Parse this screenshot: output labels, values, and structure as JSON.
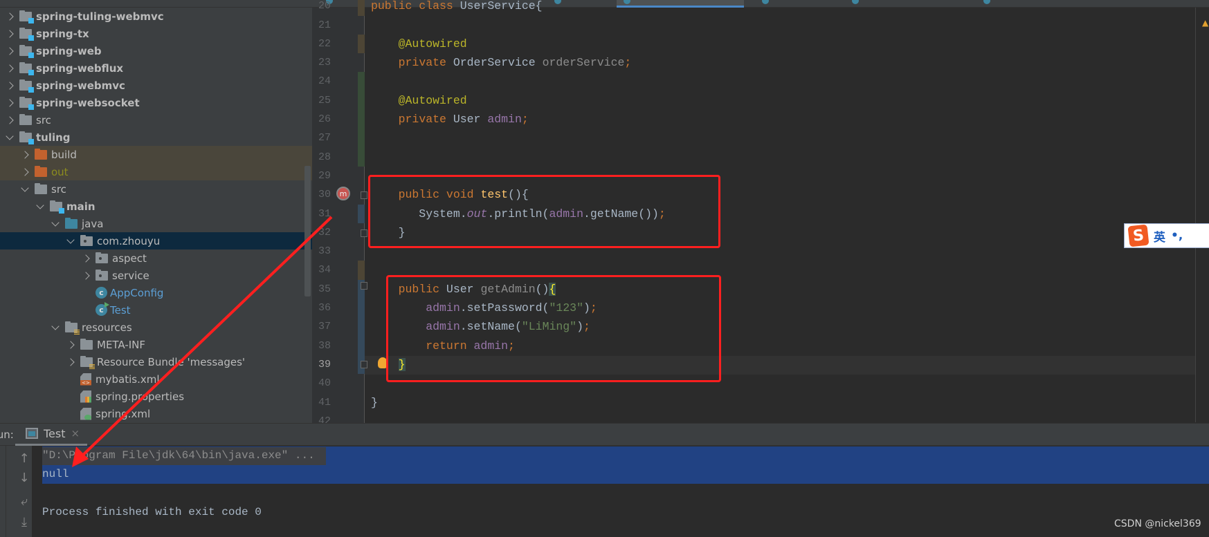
{
  "project_tree": [
    {
      "label": "spring-tuling-webmvc",
      "level": 0,
      "icon": "module-folder-icon",
      "expanded": false,
      "bold": true
    },
    {
      "label": "spring-tx",
      "level": 0,
      "icon": "module-folder-icon",
      "expanded": false,
      "bold": true
    },
    {
      "label": "spring-web",
      "level": 0,
      "icon": "module-folder-icon",
      "expanded": false,
      "bold": true
    },
    {
      "label": "spring-webflux",
      "level": 0,
      "icon": "module-folder-icon",
      "expanded": false,
      "bold": true
    },
    {
      "label": "spring-webmvc",
      "level": 0,
      "icon": "module-folder-icon",
      "expanded": false,
      "bold": true
    },
    {
      "label": "spring-websocket",
      "level": 0,
      "icon": "module-folder-icon",
      "expanded": false,
      "bold": true
    },
    {
      "label": "src",
      "level": 0,
      "icon": "folder-icon",
      "expanded": false
    },
    {
      "label": "tuling",
      "level": 0,
      "icon": "module-folder-icon",
      "expanded": true,
      "bold": true
    },
    {
      "label": "build",
      "level": 1,
      "icon": "excluded-folder-icon",
      "expanded": false,
      "excluded": true
    },
    {
      "label": "out",
      "level": 1,
      "icon": "excluded-folder-icon",
      "expanded": false,
      "excluded": true,
      "color": "olive"
    },
    {
      "label": "src",
      "level": 1,
      "icon": "folder-icon",
      "expanded": true
    },
    {
      "label": "main",
      "level": 2,
      "icon": "module-folder-icon",
      "expanded": true,
      "bold": true
    },
    {
      "label": "java",
      "level": 3,
      "icon": "source-folder-icon",
      "expanded": true
    },
    {
      "label": "com.zhouyu",
      "level": 4,
      "icon": "package-icon",
      "expanded": true,
      "selected": true
    },
    {
      "label": "aspect",
      "level": 5,
      "icon": "package-icon",
      "expanded": false
    },
    {
      "label": "service",
      "level": 5,
      "icon": "package-icon",
      "expanded": false
    },
    {
      "label": "AppConfig",
      "level": 5,
      "icon": "class-icon",
      "leaf": true,
      "color": "blue"
    },
    {
      "label": "Test",
      "level": 5,
      "icon": "runnable-class-icon",
      "leaf": true,
      "color": "blue"
    },
    {
      "label": "resources",
      "level": 3,
      "icon": "resources-folder-icon",
      "expanded": true
    },
    {
      "label": "META-INF",
      "level": 4,
      "icon": "folder-icon",
      "expanded": false
    },
    {
      "label": "Resource Bundle 'messages'",
      "level": 4,
      "icon": "resource-bundle-icon",
      "expanded": false
    },
    {
      "label": "mybatis.xml",
      "level": 4,
      "icon": "xml-file-icon",
      "leaf": true
    },
    {
      "label": "spring.properties",
      "level": 4,
      "icon": "properties-file-icon",
      "leaf": true
    },
    {
      "label": "spring.xml",
      "level": 4,
      "icon": "spring-xml-file-icon",
      "leaf": true
    }
  ],
  "editor": {
    "first_line": 20,
    "current_line": 39,
    "lines": [
      [
        {
          "t": "public class ",
          "c": "kw"
        },
        {
          "t": "UserService{",
          "c": ""
        }
      ],
      [],
      [
        {
          "t": "    "
        },
        {
          "t": "@Autowired",
          "c": "ann"
        }
      ],
      [
        {
          "t": "    "
        },
        {
          "t": "private ",
          "c": "kw"
        },
        {
          "t": "OrderService ",
          "c": ""
        },
        {
          "t": "orderService",
          "c": "unused"
        },
        {
          "t": ";",
          "c": "kw"
        }
      ],
      [],
      [
        {
          "t": "    "
        },
        {
          "t": "@Autowired",
          "c": "ann"
        }
      ],
      [
        {
          "t": "    "
        },
        {
          "t": "private ",
          "c": "kw"
        },
        {
          "t": "User ",
          "c": ""
        },
        {
          "t": "admin",
          "c": "fld"
        },
        {
          "t": ";",
          "c": "kw"
        }
      ],
      [],
      [],
      [],
      [
        {
          "t": "    "
        },
        {
          "t": "public void ",
          "c": "kw"
        },
        {
          "t": "test",
          "c": "mdecl"
        },
        {
          "t": "(){",
          "c": ""
        }
      ],
      [
        {
          "t": "       System."
        },
        {
          "t": "out",
          "c": "fld",
          "i": true
        },
        {
          "t": ".println("
        },
        {
          "t": "admin",
          "c": "fld"
        },
        {
          "t": ".getName())"
        },
        {
          "t": ";",
          "c": "kw"
        }
      ],
      [
        {
          "t": "    }"
        }
      ],
      [],
      [],
      [
        {
          "t": "    "
        },
        {
          "t": "public ",
          "c": "kw"
        },
        {
          "t": "User ",
          "c": ""
        },
        {
          "t": "getAdmin",
          "c": "unused"
        },
        {
          "t": "()"
        },
        {
          "t": "{",
          "c": "brace-hl"
        }
      ],
      [
        {
          "t": "        "
        },
        {
          "t": "admin",
          "c": "fld"
        },
        {
          "t": ".setPassword("
        },
        {
          "t": "\"123\"",
          "c": "str"
        },
        {
          "t": ")"
        },
        {
          "t": ";",
          "c": "kw"
        }
      ],
      [
        {
          "t": "        "
        },
        {
          "t": "admin",
          "c": "fld"
        },
        {
          "t": ".setName("
        },
        {
          "t": "\"LiMing\"",
          "c": "str"
        },
        {
          "t": ")"
        },
        {
          "t": ";",
          "c": "kw"
        }
      ],
      [
        {
          "t": "        "
        },
        {
          "t": "return ",
          "c": "kw"
        },
        {
          "t": "admin",
          "c": "fld"
        },
        {
          "t": ";",
          "c": "kw"
        }
      ],
      [
        {
          "t": "    "
        },
        {
          "t": "}",
          "c": "brace-hl"
        }
      ],
      [],
      [
        {
          "t": "}"
        }
      ],
      []
    ],
    "gutter_mark": "m",
    "colors": {
      "keyword": "#cc7832",
      "annotation": "#bbb529",
      "field": "#9876aa",
      "string": "#6a8759",
      "method": "#ffc66d",
      "text": "#a9b7c6"
    }
  },
  "ime": {
    "logo": "S",
    "mode": "英",
    "punct": "•,"
  },
  "run_panel": {
    "label": "Run:",
    "tab": "Test",
    "close": "×",
    "output": [
      {
        "text": "\"D:\\Program File\\jdk\\64\\bin\\java.exe\" ...",
        "color": "#8c8c8c"
      },
      {
        "text": "null",
        "color": "#a9b7c6"
      },
      {
        "text": "",
        "color": "#a9b7c6"
      },
      {
        "text": "Process finished with exit code 0",
        "color": "#a9b7c6"
      }
    ]
  },
  "annotation_color": "#ff1f1f",
  "watermark": "CSDN @nickel369"
}
